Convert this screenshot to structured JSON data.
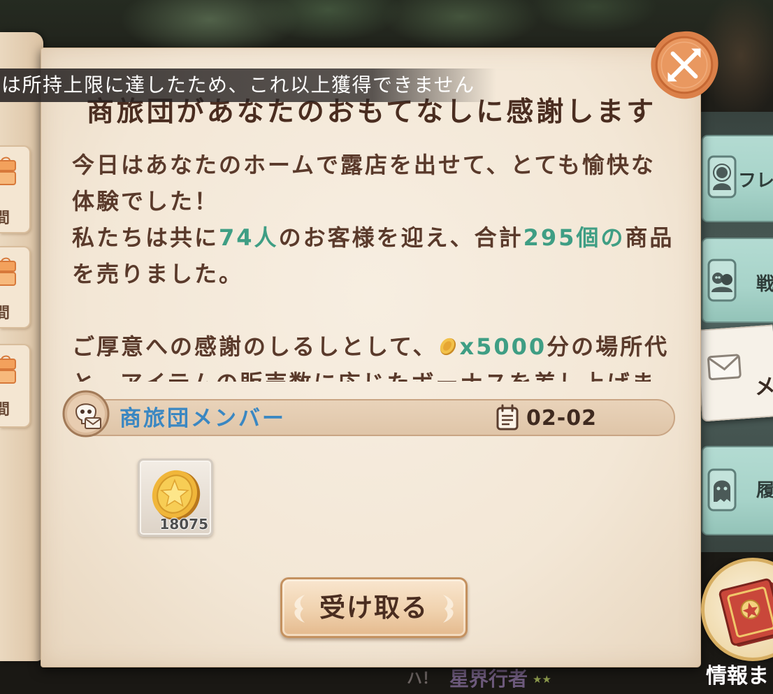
{
  "theme": {
    "paper": "#f3e7d6",
    "title_text": "#4a2d20",
    "body_text": "#5a3a2b",
    "highlight": "#3f9e84",
    "sender_name": "#3a87c2",
    "close_button": "#e58d55",
    "tab_teal": "#a7d3c9",
    "active_tab": "#f6f1e8"
  },
  "toast": {
    "text": "は所持上限に達したため、これ以上獲得できません"
  },
  "mail": {
    "title": "商旅団があなたのおもてなしに感謝します",
    "body": {
      "line1": "今日はあなたのホームで露店を出せて、とても愉快な",
      "line2": "体験でした！",
      "line3": {
        "before": "私たちは共に",
        "customers": "74人",
        "middle": "のお客様を迎え、合計",
        "items_sold": "295個の",
        "after": "商品"
      },
      "line4": "を売りました。",
      "line5": {
        "before": "ご厚意への感謝のしるしとして、",
        "currency_icon": "gold-coin-icon",
        "amount": "x5000",
        "after": "分の場所代"
      },
      "line6": "と、アイテムの販売数に応じたボーナスを差し上げま"
    },
    "sender": {
      "avatar_icon": "merchant-avatar-icon",
      "name": "商旅団メンバー",
      "date_icon": "calendar-icon",
      "date": "02-02"
    },
    "attachments": [
      {
        "icon": "star-coin-icon",
        "count": "18075"
      }
    ],
    "claim_button": {
      "label": "受け取る"
    },
    "close_button": {
      "icon": "close-icon"
    }
  },
  "side_tabs": [
    {
      "label": "フレ",
      "icon": "friend-icon",
      "active": false
    },
    {
      "label": "戦",
      "icon": "battle-icon",
      "active": false
    },
    {
      "label": "メ",
      "icon": "mail-icon",
      "active": true
    },
    {
      "label": "履",
      "icon": "history-icon",
      "active": false
    }
  ],
  "left_list": [
    {
      "icon": "gift-icon",
      "label": "間"
    },
    {
      "icon": "gift-icon",
      "label": "間"
    },
    {
      "icon": "gift-icon",
      "label": "間"
    }
  ],
  "info_button": {
    "icon": "book-icon",
    "label": "情報ま"
  },
  "background_text": {
    "exclaim": "ハ！",
    "name": "星界行者",
    "stars": "★★"
  }
}
